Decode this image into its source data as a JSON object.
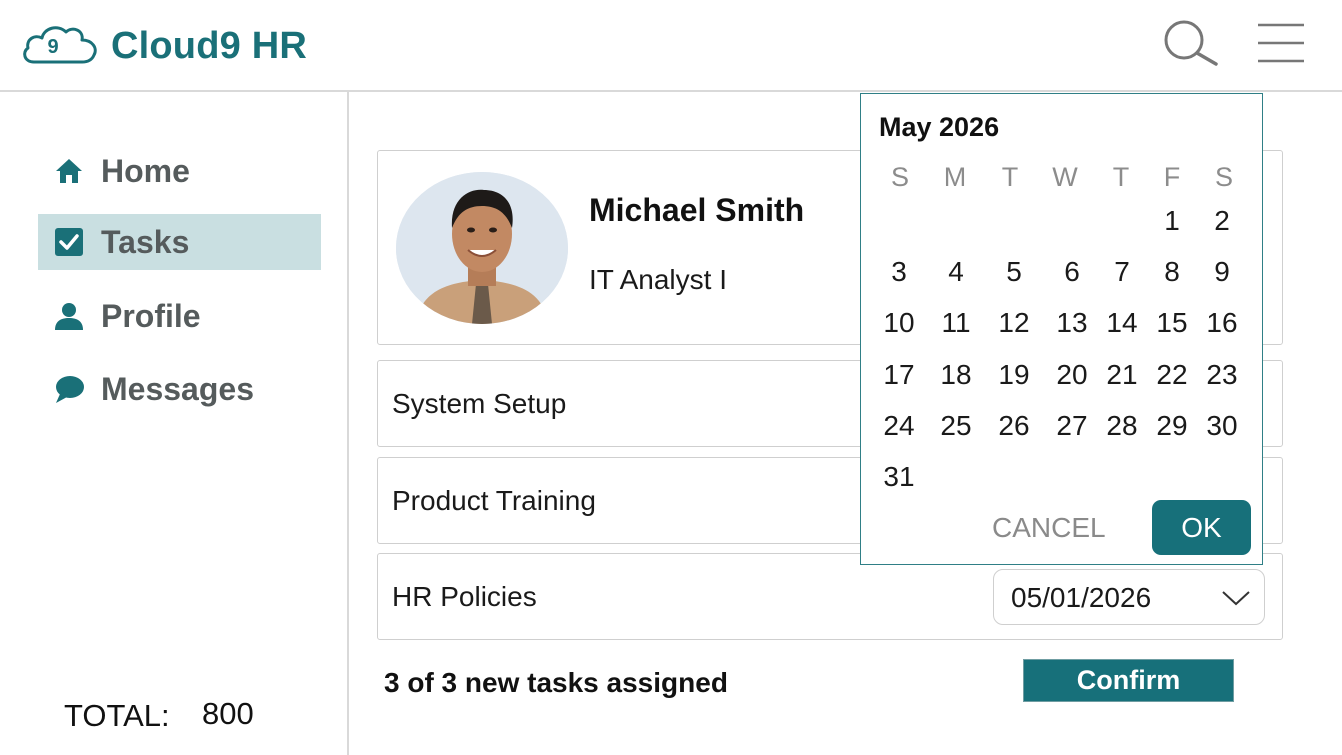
{
  "header": {
    "logo_number": "9",
    "title": "Cloud9 HR",
    "search_icon": "search-icon",
    "menu_icon": "hamburger-menu-icon"
  },
  "sidebar": {
    "items": [
      {
        "label": "Home",
        "icon": "home-icon"
      },
      {
        "label": "Tasks",
        "icon": "checkbox-icon",
        "active": true
      },
      {
        "label": "Profile",
        "icon": "user-icon"
      },
      {
        "label": "Messages",
        "icon": "chat-bubble-icon"
      }
    ],
    "total_label": "TOTAL:",
    "total_value": "800"
  },
  "profile": {
    "name": "Michael Smith",
    "role": "IT Analyst I"
  },
  "tasks": [
    {
      "label": "System Setup"
    },
    {
      "label": "Product Training"
    },
    {
      "label": "HR Policies"
    }
  ],
  "date_field": {
    "value": "05/01/2026"
  },
  "footer": {
    "assigned_text": "3 of 3 new tasks assigned",
    "confirm_label": "Confirm"
  },
  "calendar": {
    "month_label": "May 2026",
    "weekdays": [
      "S",
      "M",
      "T",
      "W",
      "T",
      "F",
      "S"
    ],
    "first_weekday_index": 5,
    "days_in_month": 31,
    "cancel_label": "CANCEL",
    "ok_label": "OK"
  },
  "colors": {
    "brand": "#1a7078",
    "active_nav_bg": "#c9dfe1",
    "button_bg": "#17707a"
  }
}
